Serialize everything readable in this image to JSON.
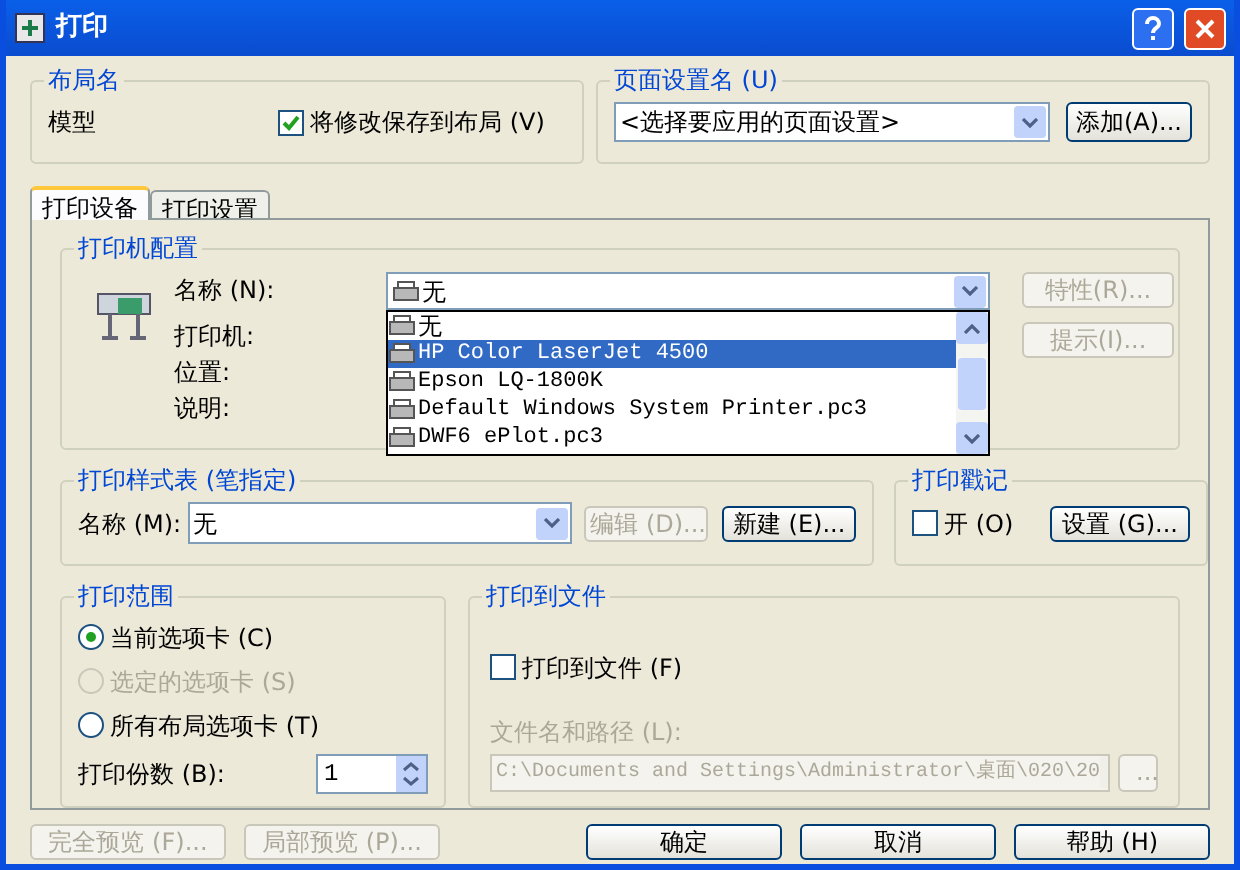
{
  "window": {
    "title": "打印"
  },
  "layout_name": {
    "title": "布局名",
    "value": "模型",
    "save_checkbox": {
      "label": "将修改保存到布局 (V)",
      "checked": true
    }
  },
  "page_setup": {
    "title": "页面设置名 (U)",
    "value": "<选择要应用的页面设置>",
    "add_button": "添加(A)..."
  },
  "tabs": [
    {
      "label": "打印设备",
      "selected": true
    },
    {
      "label": "打印设置",
      "selected": false
    }
  ],
  "printer_config": {
    "title": "打印机配置",
    "name_label": "名称 (N):",
    "name_value": "无",
    "labels": [
      "打印机:",
      "位置:",
      "说明:"
    ],
    "properties_button": {
      "label": "特性(R)...",
      "disabled": true
    },
    "hints_button": {
      "label": "提示(I)...",
      "disabled": true
    },
    "dropdown_items": [
      {
        "label": "无",
        "selected": false
      },
      {
        "label": "HP Color LaserJet 4500",
        "selected": true
      },
      {
        "label": "Epson LQ-1800K",
        "selected": false
      },
      {
        "label": "Default Windows System Printer.pc3",
        "selected": false
      },
      {
        "label": "DWF6 ePlot.pc3",
        "selected": false
      }
    ]
  },
  "plot_style": {
    "title": "打印样式表 (笔指定)",
    "name_label": "名称 (M):",
    "value": "无",
    "edit_button": {
      "label": "编辑 (D)...",
      "disabled": true
    },
    "new_button": {
      "label": "新建 (E)...",
      "disabled": false
    }
  },
  "plot_stamp": {
    "title": "打印戳记",
    "on_checkbox": {
      "label": "开 (O)",
      "checked": false
    },
    "settings_button": "设置 (G)..."
  },
  "plot_range": {
    "title": "打印范围",
    "options": [
      {
        "label": "当前选项卡 (C)",
        "selected": true,
        "disabled": false
      },
      {
        "label": "选定的选项卡 (S)",
        "selected": false,
        "disabled": true
      },
      {
        "label": "所有布局选项卡 (T)",
        "selected": false,
        "disabled": false
      }
    ],
    "copies_label": "打印份数 (B):",
    "copies_value": "1"
  },
  "plot_to_file": {
    "title": "打印到文件",
    "checkbox": {
      "label": "打印到文件 (F)",
      "checked": false
    },
    "path_label": "文件名和路径 (L):",
    "path_value": "C:\\Documents and Settings\\Administrator\\桌面\\020\\20",
    "browse_button": "..."
  },
  "footer_buttons": [
    {
      "label": "完全预览 (F)...",
      "disabled": true
    },
    {
      "label": "局部预览 (P)...",
      "disabled": true
    },
    {
      "label": "确定",
      "disabled": false
    },
    {
      "label": "取消",
      "disabled": false
    },
    {
      "label": "帮助 (H)",
      "disabled": false
    }
  ]
}
